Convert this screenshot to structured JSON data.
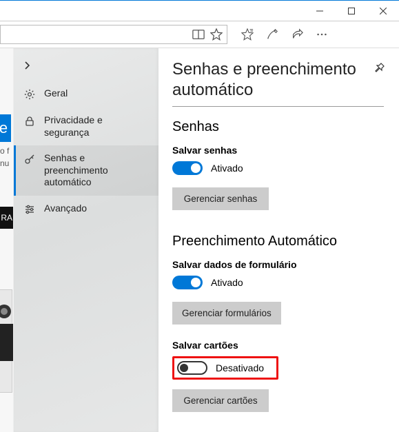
{
  "window": {
    "minimize": "minimize",
    "maximize": "maximize",
    "close": "close"
  },
  "bg": {
    "e": "e",
    "t1": "o f",
    "t2": "nu",
    "dark": "RA"
  },
  "sidebar": {
    "items": [
      {
        "label": "Geral"
      },
      {
        "label": "Privacidade e segurança"
      },
      {
        "label": "Senhas e preenchimento automático"
      },
      {
        "label": "Avançado"
      }
    ]
  },
  "main": {
    "title": "Senhas e preenchimento automático",
    "passwords": {
      "heading": "Senhas",
      "save_label": "Salvar senhas",
      "toggle_state": "Ativado",
      "manage_btn": "Gerenciar senhas"
    },
    "autofill": {
      "heading": "Preenchimento Automático",
      "forms_label": "Salvar dados de formulário",
      "forms_toggle_state": "Ativado",
      "forms_manage_btn": "Gerenciar formulários",
      "cards_label": "Salvar cartões",
      "cards_toggle_state": "Desativado",
      "cards_manage_btn": "Gerenciar cartões"
    }
  }
}
